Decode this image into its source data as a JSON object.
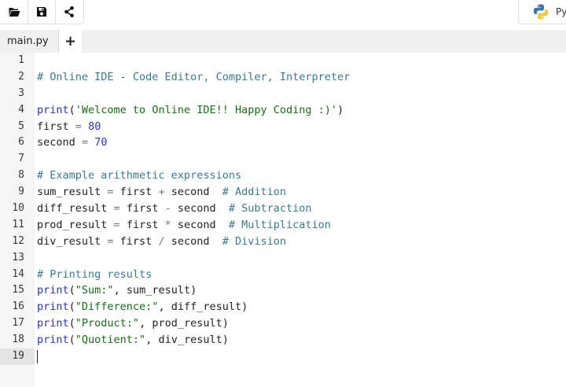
{
  "toolbar": {
    "buttons": [
      {
        "name": "open-folder-button",
        "icon": "folder-open-icon"
      },
      {
        "name": "save-button",
        "icon": "floppy-disk-icon"
      },
      {
        "name": "share-button",
        "icon": "share-icon"
      }
    ]
  },
  "language": {
    "label": "Py",
    "icon": "python-logo-icon"
  },
  "tabs": {
    "items": [
      {
        "label": "main.py"
      }
    ],
    "add_label": "+"
  },
  "editor": {
    "active_line": 19,
    "lines": [
      {
        "n": "1",
        "tokens": []
      },
      {
        "n": "2",
        "tokens": [
          {
            "t": "# Online IDE - Code Editor, Compiler, Interpreter",
            "k": "comment"
          }
        ]
      },
      {
        "n": "3",
        "tokens": []
      },
      {
        "n": "4",
        "tokens": [
          {
            "t": "print",
            "k": "fn"
          },
          {
            "t": "(",
            "k": "plain"
          },
          {
            "t": "'Welcome to Online IDE!! Happy Coding :)'",
            "k": "str"
          },
          {
            "t": ")",
            "k": "plain"
          }
        ]
      },
      {
        "n": "5",
        "tokens": [
          {
            "t": "first ",
            "k": "plain"
          },
          {
            "t": "=",
            "k": "op"
          },
          {
            "t": " ",
            "k": "plain"
          },
          {
            "t": "80",
            "k": "num"
          }
        ]
      },
      {
        "n": "6",
        "tokens": [
          {
            "t": "second ",
            "k": "plain"
          },
          {
            "t": "=",
            "k": "op"
          },
          {
            "t": " ",
            "k": "plain"
          },
          {
            "t": "70",
            "k": "num"
          }
        ]
      },
      {
        "n": "7",
        "tokens": []
      },
      {
        "n": "8",
        "tokens": [
          {
            "t": "# Example arithmetic expressions",
            "k": "comment"
          }
        ]
      },
      {
        "n": "9",
        "tokens": [
          {
            "t": "sum_result ",
            "k": "plain"
          },
          {
            "t": "=",
            "k": "op"
          },
          {
            "t": " first ",
            "k": "plain"
          },
          {
            "t": "+",
            "k": "op"
          },
          {
            "t": " second  ",
            "k": "plain"
          },
          {
            "t": "# Addition",
            "k": "comment"
          }
        ]
      },
      {
        "n": "10",
        "tokens": [
          {
            "t": "diff_result ",
            "k": "plain"
          },
          {
            "t": "=",
            "k": "op"
          },
          {
            "t": " first ",
            "k": "plain"
          },
          {
            "t": "-",
            "k": "op"
          },
          {
            "t": " second  ",
            "k": "plain"
          },
          {
            "t": "# Subtraction",
            "k": "comment"
          }
        ]
      },
      {
        "n": "11",
        "tokens": [
          {
            "t": "prod_result ",
            "k": "plain"
          },
          {
            "t": "=",
            "k": "op"
          },
          {
            "t": " first ",
            "k": "plain"
          },
          {
            "t": "*",
            "k": "op"
          },
          {
            "t": " second  ",
            "k": "plain"
          },
          {
            "t": "# Multiplication",
            "k": "comment"
          }
        ]
      },
      {
        "n": "12",
        "tokens": [
          {
            "t": "div_result ",
            "k": "plain"
          },
          {
            "t": "=",
            "k": "op"
          },
          {
            "t": " first ",
            "k": "plain"
          },
          {
            "t": "/",
            "k": "op"
          },
          {
            "t": " second  ",
            "k": "plain"
          },
          {
            "t": "# Division",
            "k": "comment"
          }
        ]
      },
      {
        "n": "13",
        "tokens": []
      },
      {
        "n": "14",
        "tokens": [
          {
            "t": "# Printing results",
            "k": "comment"
          }
        ]
      },
      {
        "n": "15",
        "tokens": [
          {
            "t": "print",
            "k": "fn"
          },
          {
            "t": "(",
            "k": "plain"
          },
          {
            "t": "\"Sum:\"",
            "k": "str"
          },
          {
            "t": ", sum_result)",
            "k": "plain"
          }
        ]
      },
      {
        "n": "16",
        "tokens": [
          {
            "t": "print",
            "k": "fn"
          },
          {
            "t": "(",
            "k": "plain"
          },
          {
            "t": "\"Difference:\"",
            "k": "str"
          },
          {
            "t": ", diff_result)",
            "k": "plain"
          }
        ]
      },
      {
        "n": "17",
        "tokens": [
          {
            "t": "print",
            "k": "fn"
          },
          {
            "t": "(",
            "k": "plain"
          },
          {
            "t": "\"Product:\"",
            "k": "str"
          },
          {
            "t": ", prod_result)",
            "k": "plain"
          }
        ]
      },
      {
        "n": "18",
        "tokens": [
          {
            "t": "print",
            "k": "fn"
          },
          {
            "t": "(",
            "k": "plain"
          },
          {
            "t": "\"Quotient:\"",
            "k": "str"
          },
          {
            "t": ", div_result)",
            "k": "plain"
          }
        ]
      },
      {
        "n": "19",
        "tokens": []
      }
    ]
  }
}
